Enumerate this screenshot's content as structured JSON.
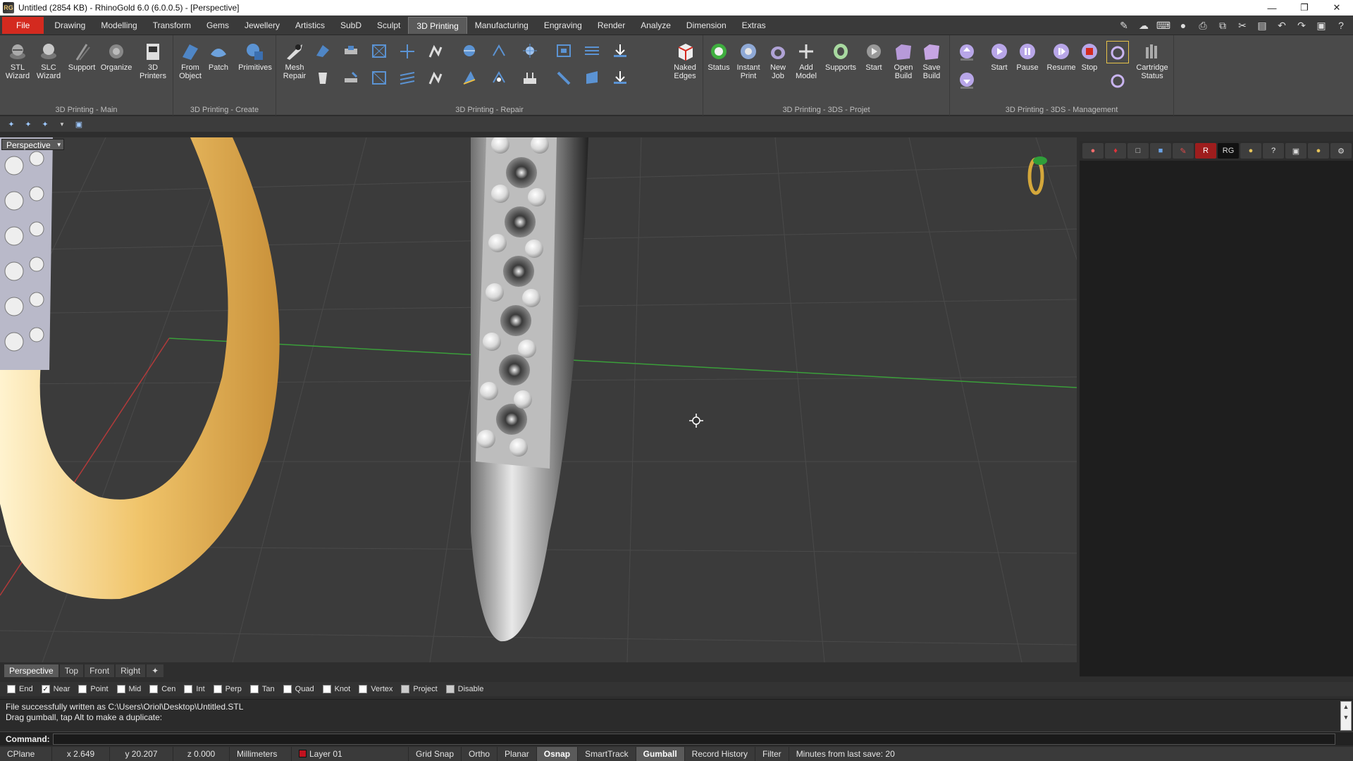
{
  "window": {
    "title": "Untitled (2854 KB) - RhinoGold 6.0 (6.0.0.5) - [Perspective]",
    "app_icon": "RG",
    "controls": [
      "minimize-icon",
      "restore-icon",
      "close-icon"
    ]
  },
  "menu": {
    "items": [
      "File",
      "Drawing",
      "Modelling",
      "Transform",
      "Gems",
      "Jewellery",
      "Artistics",
      "SubD",
      "Sculpt",
      "3D Printing",
      "Manufacturing",
      "Engraving",
      "Render",
      "Analyze",
      "Dimension",
      "Extras"
    ],
    "active": "3D Printing"
  },
  "ribbon": {
    "groups": {
      "main": "3D Printing - Main",
      "create": "3D Printing - Create",
      "repair": "3D Printing - Repair",
      "projet": "3D Printing - 3DS - Projet",
      "management": "3D Printing - 3DS - Management"
    },
    "buttons": {
      "stl_wizard": "STL\nWizard",
      "slc_wizard": "SLC\nWizard",
      "support": "Support",
      "organize": "Organize",
      "printers": "3D\nPrinters",
      "from_object": "From\nObject",
      "patch": "Patch",
      "primitives": "Primitives",
      "mesh_repair": "Mesh\nRepair",
      "naked_edges": "Naked\nEdges",
      "status": "Status",
      "instant_print": "Instant\nPrint",
      "new_job": "New\nJob",
      "add_model": "Add\nModel",
      "supports": "Supports",
      "start_projet": "Start",
      "open_build": "Open\nBuild",
      "save_build": "Save\nBuild",
      "start_mgmt": "Start",
      "pause": "Pause",
      "resume": "Resume",
      "stop": "Stop",
      "cartridge_status": "Cartridge\nStatus"
    }
  },
  "viewport": {
    "label": "Perspective",
    "colors": {
      "grid_bg": "#3b3b3b",
      "grid_line": "#4a4a4a",
      "x_axis": "#b23a3a",
      "y_axis": "#3a9e3a",
      "gold": "#f0c46a",
      "silver": "#d9d9d9"
    }
  },
  "viewport_tabs": [
    "Perspective",
    "Top",
    "Front",
    "Right"
  ],
  "osnap": [
    {
      "label": "End",
      "checked": false
    },
    {
      "label": "Near",
      "checked": true
    },
    {
      "label": "Point",
      "checked": false
    },
    {
      "label": "Mid",
      "checked": false
    },
    {
      "label": "Cen",
      "checked": false
    },
    {
      "label": "Int",
      "checked": false
    },
    {
      "label": "Perp",
      "checked": false
    },
    {
      "label": "Tan",
      "checked": false
    },
    {
      "label": "Quad",
      "checked": false
    },
    {
      "label": "Knot",
      "checked": false
    },
    {
      "label": "Vertex",
      "checked": false
    },
    {
      "label": "Project",
      "checked": false
    },
    {
      "label": "Disable",
      "checked": false
    }
  ],
  "command": {
    "history": [
      "File successfully written as C:\\Users\\Oriol\\Desktop\\Untitled.STL",
      "Drag gumball, tap Alt to make a duplicate:"
    ],
    "prompt_label": "Command:"
  },
  "status": {
    "cplane": "CPlane",
    "x": "x 2.649",
    "y": "y 20.207",
    "z": "z 0.000",
    "units": "Millimeters",
    "layer": "Layer 01",
    "layer_color": "#c1121f",
    "toggles": [
      {
        "label": "Grid Snap",
        "on": false
      },
      {
        "label": "Ortho",
        "on": false
      },
      {
        "label": "Planar",
        "on": false
      },
      {
        "label": "Osnap",
        "on": true
      },
      {
        "label": "SmartTrack",
        "on": false
      },
      {
        "label": "Gumball",
        "on": true
      },
      {
        "label": "Record History",
        "on": false
      },
      {
        "label": "Filter",
        "on": false
      }
    ],
    "save_info": "Minutes from last save: 20"
  }
}
